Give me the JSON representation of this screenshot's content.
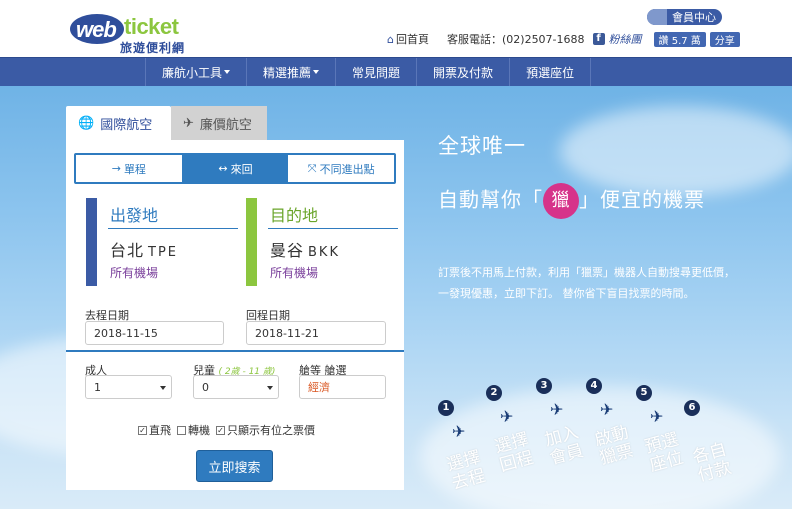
{
  "header": {
    "logo_web": "web",
    "logo_ticket": "ticket",
    "logo_sub": "旅遊便利網",
    "member_label": "會員中心",
    "home_label": "回首頁",
    "phone_label": "客服電話：(02)2507-1688",
    "fb_icon": "f",
    "fans_label": "粉絲團",
    "like_label": "讚 5.7 萬",
    "share_label": "分享"
  },
  "nav": {
    "items": [
      {
        "label": "廉航小工具",
        "dropdown": true
      },
      {
        "label": "精選推薦",
        "dropdown": true
      },
      {
        "label": "常見問題",
        "dropdown": false
      },
      {
        "label": "開票及付款",
        "dropdown": false
      },
      {
        "label": "預選座位",
        "dropdown": false
      }
    ]
  },
  "search": {
    "tabs": [
      {
        "label": "國際航空",
        "icon": "globe-icon"
      },
      {
        "label": "廉價航空",
        "icon": "plane-icon"
      }
    ],
    "trip_types": [
      {
        "label": "單程",
        "symbol": "→"
      },
      {
        "label": "來回",
        "symbol": "↔"
      },
      {
        "label": "不同進出點",
        "symbol": "⤧"
      }
    ],
    "selected_trip": "來回",
    "origin": {
      "title": "出發地",
      "city": "台北",
      "code": "TPE",
      "airport": "所有機場",
      "color": "#3b5ba5"
    },
    "destination": {
      "title": "目的地",
      "city": "曼谷",
      "code": "BKK",
      "airport": "所有機場",
      "color": "#8cc63f"
    },
    "depart_label": "去程日期",
    "depart_value": "2018-11-15",
    "return_label": "回程日期",
    "return_value": "2018-11-21",
    "adult_label": "成人",
    "adult_value": "1",
    "child_label": "兒童",
    "child_hint": "( 2歲 - 11 歲)",
    "child_value": "0",
    "cabin_label": "艙等  艙選",
    "cabin_value": "經濟",
    "checks": [
      {
        "label": "直飛",
        "checked": true
      },
      {
        "label": "轉機",
        "checked": false
      },
      {
        "label": "只顯示有位之票價",
        "checked": true
      }
    ],
    "submit_label": "立即搜索"
  },
  "promo": {
    "line1": "全球唯一",
    "line2a": "自動幫你「",
    "hunt": "獵",
    "line2b": "」便宜的機票",
    "desc": "訂票後不用馬上付款，利用「獵票」機器人自動搜尋更低價，一發現優惠，立即下訂。 替你省下盲目找票的時間。",
    "steps": [
      {
        "num": "1",
        "text": "選擇去程"
      },
      {
        "num": "2",
        "text": "選擇回程"
      },
      {
        "num": "3",
        "text": "加入會員"
      },
      {
        "num": "4",
        "text": "啟動獵票"
      },
      {
        "num": "5",
        "text": "預選座位"
      },
      {
        "num": "6",
        "text": "各自付款"
      }
    ]
  }
}
